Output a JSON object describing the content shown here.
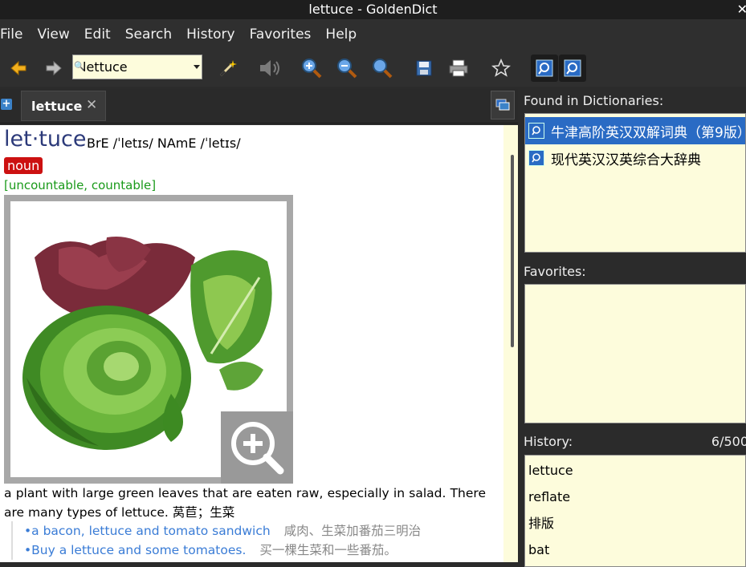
{
  "window": {
    "title": "lettuce - GoldenDict"
  },
  "menu": [
    "File",
    "Edit",
    "Search",
    "History",
    "Favorites",
    "Help"
  ],
  "menu_view": "View",
  "toolbar": {
    "search_value": "lettuce",
    "icons": [
      "back-arrow-icon",
      "forward-arrow-icon",
      "magic-wand-icon",
      "speaker-icon",
      "zoom-in-icon",
      "zoom-out-icon",
      "zoom-normal-icon",
      "save-icon",
      "print-icon",
      "star-icon",
      "scan-popup-icon",
      "dictionary-bar-icon"
    ]
  },
  "tabs": [
    {
      "label": "lettuce",
      "close": "✕"
    }
  ],
  "article": {
    "headword": "let·tuce",
    "pron": "BrE  /ˈletɪs/   NAmE  /ˈletɪs/",
    "pos": "noun",
    "grammar": "[uncountable, countable]",
    "definition": "a plant with large green leaves that are eaten raw, especially in salad. There are many types of lettuce.",
    "definition_zh": "莴苣；生菜",
    "examples": [
      {
        "en": "•a bacon, lettuce and tomato sandwich",
        "zh": "咸肉、生菜加番茄三明治"
      },
      {
        "en": "•Buy a lettuce and some tomatoes.",
        "zh": "买一棵生菜和一些番茄。"
      }
    ]
  },
  "found": {
    "title": "Found in Dictionaries:",
    "items": [
      {
        "label": "牛津高阶英汉双解词典（第9版）",
        "selected": true
      },
      {
        "label": "现代英汉汉英综合大辞典",
        "selected": false
      }
    ]
  },
  "favorites": {
    "title": "Favorites:"
  },
  "history": {
    "title": "History:",
    "count": "6/500",
    "items": [
      "lettuce",
      "reflate",
      "排版",
      "bat"
    ]
  },
  "colors": {
    "accent": "#2a6bc4",
    "headword": "#2c3a7a",
    "pos_badge": "#cc1111",
    "grammar": "#1a9a1a",
    "example": "#3a7cd6",
    "panel_bg": "#fdfcdc"
  }
}
